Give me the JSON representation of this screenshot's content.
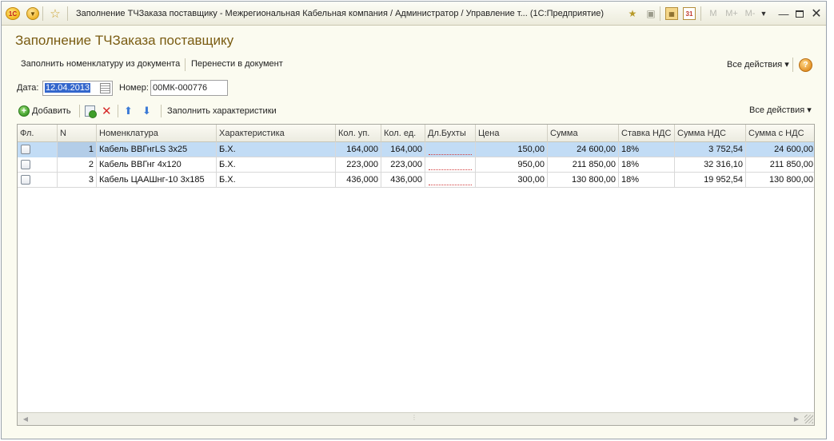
{
  "window": {
    "logo_text": "1С",
    "title": "Заполнение ТЧЗаказа поставщику - Межрегиональная Кабельная компания / Администратор /  Управление т...  (1С:Предприятие)",
    "mem_m": "M",
    "mem_plus": "M+",
    "mem_minus": "M-",
    "calendar_day": "31"
  },
  "form": {
    "title": "Заполнение ТЧЗаказа поставщику",
    "commands": {
      "fill_from_doc": "Заполнить номенклатуру из документа",
      "transfer_to_doc": "Перенести в документ",
      "all_actions": "Все действия ▾",
      "help": "?"
    },
    "date_label": "Дата:",
    "date_value": "12.04.2013",
    "number_label": "Номер:",
    "number_value": "00МК-000776"
  },
  "table_toolbar": {
    "add": "Добавить",
    "fill_characteristics": "Заполнить характеристики",
    "all_actions": "Все действия ▾"
  },
  "table": {
    "columns": [
      "Фл.",
      "N",
      "Номенклатура",
      "Характеристика",
      "Кол. уп.",
      "Кол. ед.",
      "Дл.Бухты",
      "Цена",
      "Сумма",
      "Ставка НДС",
      "Сумма НДС",
      "Сумма с НДС"
    ],
    "rows": [
      {
        "n": "1",
        "item": "Кабель ВВГнгLS 3х25",
        "char": "Б.Х.",
        "qty_pack": "164,000",
        "qty_unit": "164,000",
        "length": "",
        "price": "150,00",
        "sum": "24 600,00",
        "vat_rate": "18%",
        "vat_sum": "3 752,54",
        "sum_vat": "24 600,00"
      },
      {
        "n": "2",
        "item": "Кабель ВВГнг 4х120",
        "char": "Б.Х.",
        "qty_pack": "223,000",
        "qty_unit": "223,000",
        "length": "",
        "price": "950,00",
        "sum": "211 850,00",
        "vat_rate": "18%",
        "vat_sum": "32 316,10",
        "sum_vat": "211 850,00"
      },
      {
        "n": "3",
        "item": "Кабель ЦААШнг-10 3х185",
        "char": "Б.Х.",
        "qty_pack": "436,000",
        "qty_unit": "436,000",
        "length": "",
        "price": "300,00",
        "sum": "130 800,00",
        "vat_rate": "18%",
        "vat_sum": "19 952,54",
        "sum_vat": "130 800,00"
      }
    ]
  },
  "colors": {
    "title_text": "#7a5c12",
    "selected_row": "#c2dcf5",
    "delete_icon": "#d62b2b",
    "arrow_icons": "#3d7bd6"
  }
}
